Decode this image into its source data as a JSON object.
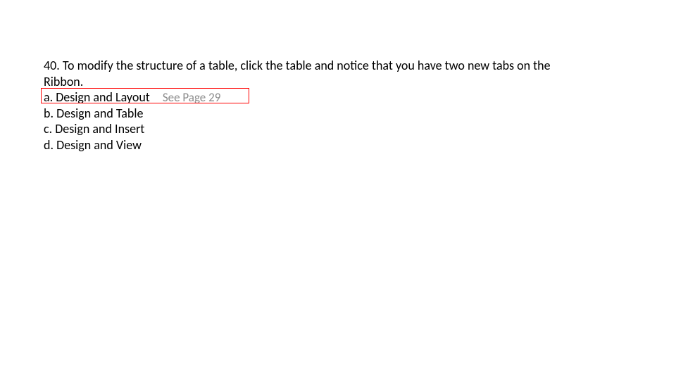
{
  "question": {
    "number": "40.",
    "text_line1": "40. To modify the structure of a table, click the table and notice that you have two new tabs on the",
    "text_line2": "Ribbon."
  },
  "choices": {
    "a": "a. Design and Layout",
    "b": "b. Design and Table",
    "c": "c. Design and Insert",
    "d": "d. Design and View"
  },
  "annotation": "See Page 29"
}
